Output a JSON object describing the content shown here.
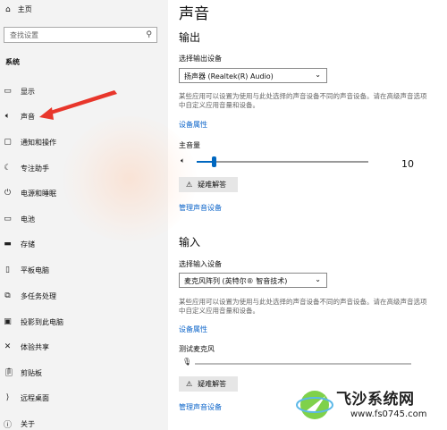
{
  "sidebar": {
    "home_label": "主页",
    "search_placeholder": "查找设置",
    "section_title": "系统",
    "items": [
      {
        "label": "显示",
        "icon": "monitor-icon"
      },
      {
        "label": "声音",
        "icon": "speaker-icon"
      },
      {
        "label": "通知和操作",
        "icon": "message-icon"
      },
      {
        "label": "专注助手",
        "icon": "moon-icon"
      },
      {
        "label": "电源和睡眠",
        "icon": "power-icon"
      },
      {
        "label": "电池",
        "icon": "battery-icon"
      },
      {
        "label": "存储",
        "icon": "drive-icon"
      },
      {
        "label": "平板电脑",
        "icon": "tablet-icon"
      },
      {
        "label": "多任务处理",
        "icon": "multitask-icon"
      },
      {
        "label": "投影到此电脑",
        "icon": "project-icon"
      },
      {
        "label": "体验共享",
        "icon": "share-icon"
      },
      {
        "label": "剪贴板",
        "icon": "clipboard-icon"
      },
      {
        "label": "远程桌面",
        "icon": "remote-icon"
      },
      {
        "label": "关于",
        "icon": "info-icon"
      }
    ]
  },
  "main": {
    "title": "声音",
    "output": {
      "heading": "输出",
      "select_label": "选择输出设备",
      "device": "扬声器 (Realtek(R) Audio)",
      "description": "某些应用可以设置为使用与此处选择的声音设备不同的声音设备。请在高级声音选项中自定义应用音量和设备。",
      "properties_link": "设备属性",
      "volume_label": "主音量",
      "volume_value": "10",
      "volume_level": 10,
      "troubleshoot": "疑难解答",
      "manage_link": "管理声音设备"
    },
    "input": {
      "heading": "输入",
      "select_label": "选择输入设备",
      "device": "麦克风阵列 (英特尔® 智音技术)",
      "description": "某些应用可以设置为使用与此处选择的声音设备不同的声音设备。请在高级声音选项中自定义应用音量和设备。",
      "properties_link": "设备属性",
      "test_label": "测试麦克风",
      "troubleshoot": "疑难解答",
      "manage_link": "管理声音设备"
    }
  },
  "watermark": {
    "name": "飞沙系统网",
    "url": "www.fs0745.com"
  },
  "colors": {
    "accent": "#0067c0",
    "link": "#0a63c9",
    "arrow": "#e8362b"
  }
}
